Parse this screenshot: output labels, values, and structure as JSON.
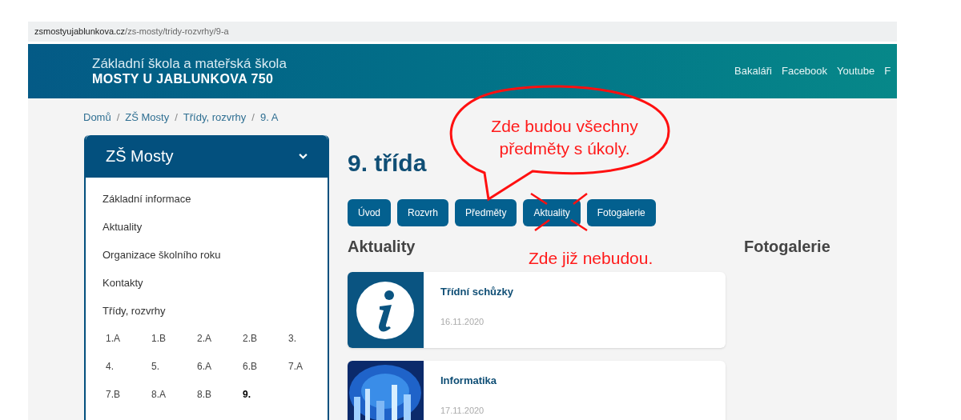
{
  "address_bar": {
    "url_host": "zsmostyujablunkova.cz",
    "url_path": "/zs-mosty/tridy-rozvrhy/9-a"
  },
  "header": {
    "line_1": "Základní škola a mateřská škola",
    "line_2": "MOSTY U JABLUNKOVA 750",
    "nav": [
      "Bakaláři",
      "Facebook",
      "Youtube",
      "F"
    ]
  },
  "breadcrumb": {
    "separator": "/",
    "items": [
      "Domů",
      "ZŠ Mosty",
      "Třídy, rozvrhy",
      "9. A"
    ]
  },
  "sidebar": {
    "title": "ZŠ Mosty",
    "expanded": true,
    "items": [
      "Základní informace",
      "Aktuality",
      "Organizace školního roku",
      "Kontakty",
      "Třídy, rozvrhy"
    ],
    "classes": [
      {
        "label": "1.A",
        "selected": false
      },
      {
        "label": "1.B",
        "selected": false
      },
      {
        "label": "2.A",
        "selected": false
      },
      {
        "label": "2.B",
        "selected": false
      },
      {
        "label": "3.",
        "selected": false
      },
      {
        "label": "4.",
        "selected": false
      },
      {
        "label": "5.",
        "selected": false
      },
      {
        "label": "6.A",
        "selected": false
      },
      {
        "label": "6.B",
        "selected": false
      },
      {
        "label": "7.A",
        "selected": false
      },
      {
        "label": "7.B",
        "selected": false
      },
      {
        "label": "8.A",
        "selected": false
      },
      {
        "label": "8.B",
        "selected": false
      },
      {
        "label": "9.",
        "selected": true
      }
    ]
  },
  "page_title": "9. třída",
  "buttons": [
    {
      "label": "Úvod",
      "crossed_out": false
    },
    {
      "label": "Rozvrh",
      "crossed_out": false
    },
    {
      "label": "Předměty",
      "crossed_out": false
    },
    {
      "label": "Aktuality",
      "crossed_out": true
    },
    {
      "label": "Fotogalerie",
      "crossed_out": false
    }
  ],
  "news": {
    "heading": "Aktuality",
    "items": [
      {
        "kind": "info",
        "title": "Třídní schůzky",
        "date": "16.11.2020"
      },
      {
        "kind": "picture",
        "title": "Informatika",
        "date": "17.11.2020"
      }
    ]
  },
  "gallery": {
    "heading": "Fotogalerie"
  },
  "annotations": [
    {
      "kind": "speech_bubble",
      "text": "Zde budou všechny předměty s úkoly."
    },
    {
      "kind": "note",
      "text": "Zde již nebudou."
    }
  ]
}
